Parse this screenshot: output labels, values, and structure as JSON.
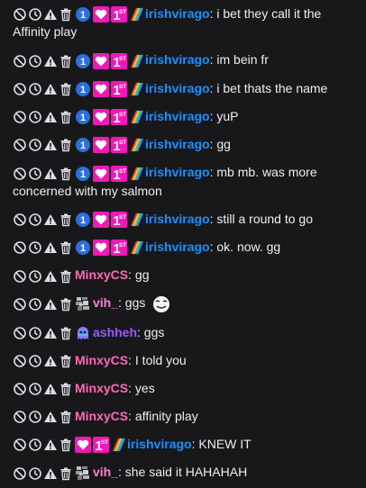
{
  "colors": {
    "background": "#18181b",
    "text": "#efeff1",
    "irishvirago": "#1e90ff",
    "MinxyCS": "#ff69b4",
    "vih_": "#ff7fd5",
    "ashheh": "#9b59ff",
    "sub_badge": "#f018b6",
    "prediction_badge": "#2c6fde"
  },
  "mod_icons": [
    "ban-icon",
    "timeout-icon",
    "warn-icon",
    "delete-icon"
  ],
  "messages": [
    {
      "user": "irishvirago",
      "badges": [
        "prediction-blue-1-badge",
        "sub-heart-badge",
        "sub-1st-badge",
        "rainbow-pride-badge"
      ],
      "text": "i bet they call it the Affinity play"
    },
    {
      "user": "irishvirago",
      "badges": [
        "prediction-blue-1-badge",
        "sub-heart-badge",
        "sub-1st-badge",
        "rainbow-pride-badge"
      ],
      "text": "im bein fr"
    },
    {
      "user": "irishvirago",
      "badges": [
        "prediction-blue-1-badge",
        "sub-heart-badge",
        "sub-1st-badge",
        "rainbow-pride-badge"
      ],
      "text": "i bet thats the name"
    },
    {
      "user": "irishvirago",
      "badges": [
        "prediction-blue-1-badge",
        "sub-heart-badge",
        "sub-1st-badge",
        "rainbow-pride-badge"
      ],
      "text": "yuP"
    },
    {
      "user": "irishvirago",
      "badges": [
        "prediction-blue-1-badge",
        "sub-heart-badge",
        "sub-1st-badge",
        "rainbow-pride-badge"
      ],
      "text": "gg"
    },
    {
      "user": "irishvirago",
      "badges": [
        "prediction-blue-1-badge",
        "sub-heart-badge",
        "sub-1st-badge",
        "rainbow-pride-badge"
      ],
      "text": "mb mb. was more concerned with my salmon"
    },
    {
      "user": "irishvirago",
      "badges": [
        "prediction-blue-1-badge",
        "sub-heart-badge",
        "sub-1st-badge",
        "rainbow-pride-badge"
      ],
      "text": "still a round to go"
    },
    {
      "user": "irishvirago",
      "badges": [
        "prediction-blue-1-badge",
        "sub-heart-badge",
        "sub-1st-badge",
        "rainbow-pride-badge"
      ],
      "text": "ok. now. gg"
    },
    {
      "user": "MinxyCS",
      "badges": [],
      "text": "gg"
    },
    {
      "user": "vih_",
      "badges": [
        "glitch-badge"
      ],
      "text": "ggs",
      "emote": "smirk-emote"
    },
    {
      "user": "ashheh",
      "badges": [
        "ghost-badge"
      ],
      "text": "ggs"
    },
    {
      "user": "MinxyCS",
      "badges": [],
      "text": "I told you"
    },
    {
      "user": "MinxyCS",
      "badges": [],
      "text": "yes"
    },
    {
      "user": "MinxyCS",
      "badges": [],
      "text": "affinity play"
    },
    {
      "user": "irishvirago",
      "badges": [
        "sub-heart-badge",
        "sub-1st-badge",
        "rainbow-pride-badge"
      ],
      "text": "KNEW IT"
    },
    {
      "user": "vih_",
      "badges": [
        "glitch-badge"
      ],
      "text": "she said it HAHAHAH"
    }
  ]
}
